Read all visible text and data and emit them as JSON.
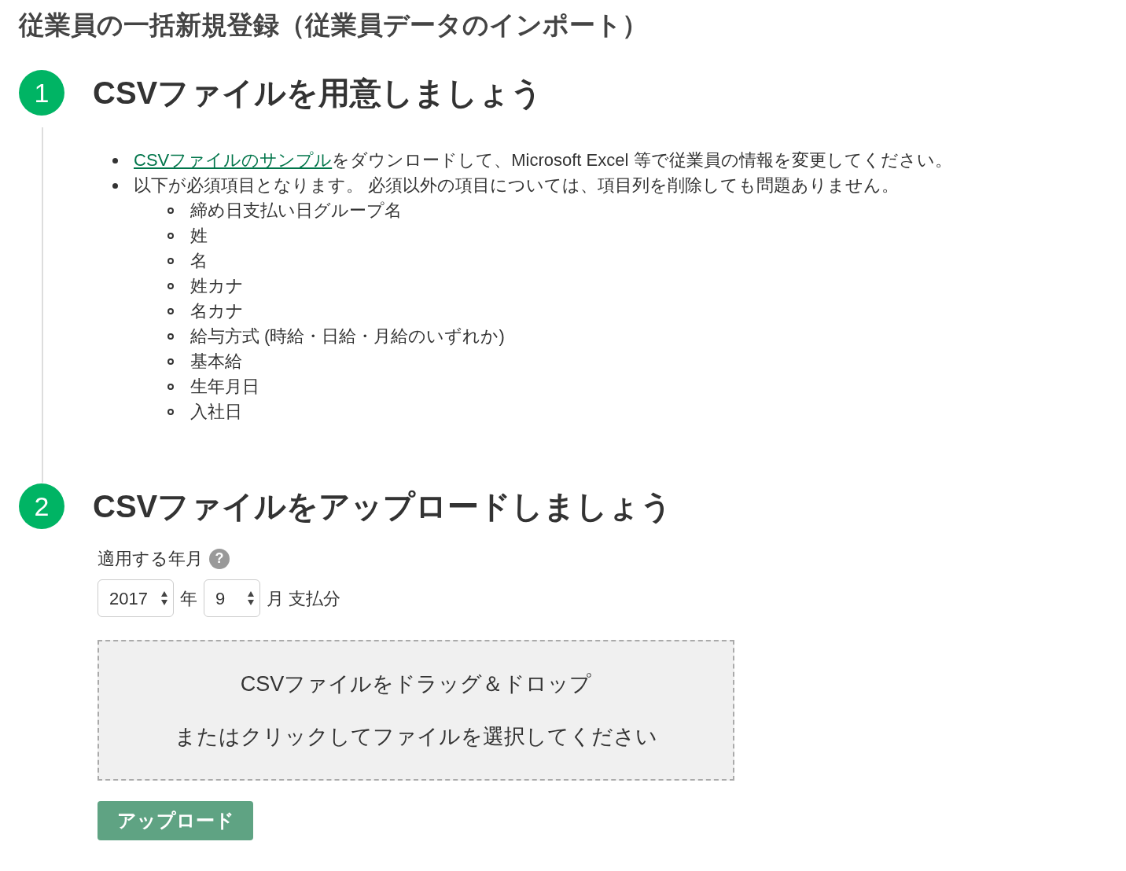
{
  "page_title": "従業員の一括新規登録（従業員データのインポート）",
  "steps": [
    {
      "number": "1",
      "title": "CSVファイルを用意しましょう"
    },
    {
      "number": "2",
      "title": "CSVファイルをアップロードしましょう"
    }
  ],
  "instructions": [
    {
      "link": "CSVファイルのサンプル",
      "text": "をダウンロードして、Microsoft Excel 等で従業員の情報を変更してください。"
    },
    {
      "text": "以下が必須項目となります。 必須以外の項目については、項目列を削除しても問題ありません。",
      "children": [
        "締め日支払い日グループ名",
        "姓",
        "名",
        "姓カナ",
        "名カナ",
        "給与方式 (時給・日給・月給のいずれか)",
        "基本給",
        "生年月日",
        "入社日"
      ]
    }
  ],
  "period": {
    "label": "適用する年月",
    "help": "?",
    "year": "2017",
    "year_unit": "年",
    "month": "9",
    "month_unit": "月 支払分"
  },
  "dropzone": {
    "line1": "CSVファイルをドラッグ＆ドロップ",
    "line2": "またはクリックしてファイルを選択してください"
  },
  "upload_button": "アップロード"
}
